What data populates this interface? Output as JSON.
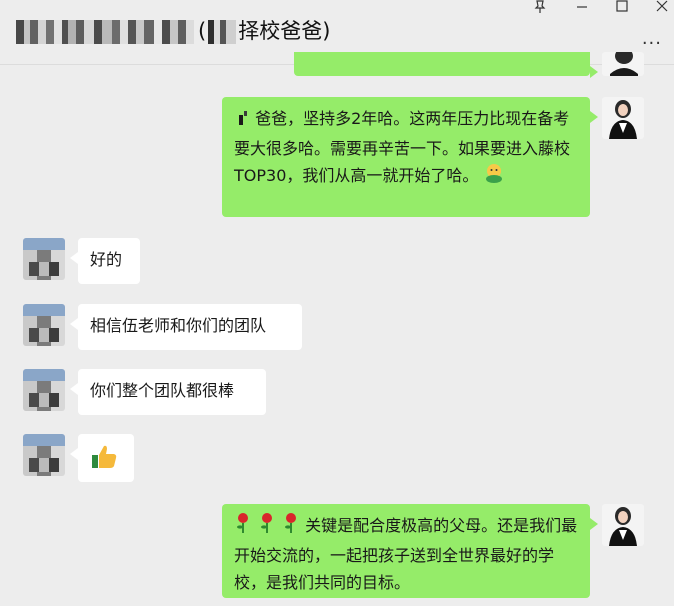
{
  "window": {
    "title_suffix": "择校爸爸)",
    "title_paren": "(",
    "pin_icon": "pin-icon",
    "minimize_icon": "minimize-icon",
    "maximize_icon": "maximize-icon",
    "close_icon": "close-icon",
    "more_label": "..."
  },
  "messages": [
    {
      "side": "out",
      "text": "爸爸，坚持多2年哈。这两年压力比现在备考要大很多哈。需要再辛苦一下。如果要进入藤校 TOP30，我们从高一就开始了哈。",
      "lead_icon": "writing-hand-emoji",
      "trail_icon": "hug-emoji"
    },
    {
      "side": "in",
      "text": "好的"
    },
    {
      "side": "in",
      "text": "相信伍老师和你们的团队"
    },
    {
      "side": "in",
      "text": "你们整个团队都很棒"
    },
    {
      "side": "in",
      "text": "",
      "icon": "thumbs-up-emoji"
    },
    {
      "side": "out",
      "text": "关键是配合度极高的父母。还是我们最开始交流的，一起把孩子送到全世界最好的学校，是我们共同的目标。",
      "lead_icon": "rose-emoji"
    }
  ],
  "colors": {
    "outgoing_bubble": "#95ec69",
    "incoming_bubble": "#ffffff",
    "background": "#ededed"
  }
}
